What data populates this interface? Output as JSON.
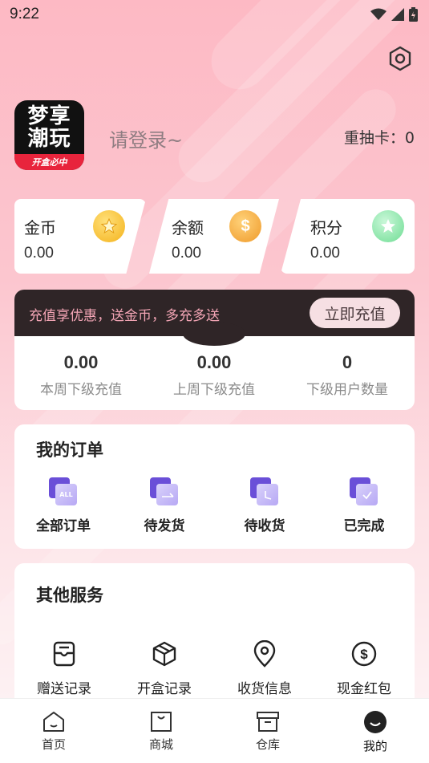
{
  "status_bar": {
    "time": "9:22"
  },
  "header": {
    "logo_line1": "梦享",
    "logo_line2": "潮玩",
    "logo_tag": "开盒必中",
    "login_prompt": "请登录~",
    "redraw_label": "重抽卡：0"
  },
  "wallet": [
    {
      "label": "金币",
      "value": "0.00",
      "icon": "gold-coin-icon"
    },
    {
      "label": "余额",
      "value": "0.00",
      "icon": "balance-coin-icon"
    },
    {
      "label": "积分",
      "value": "0.00",
      "icon": "points-star-icon"
    }
  ],
  "recharge": {
    "promo": "充值享优惠，送金币，多充多送",
    "button": "立即充值",
    "stats": [
      {
        "value": "0.00",
        "label": "本周下级充值"
      },
      {
        "value": "0.00",
        "label": "上周下级充值"
      },
      {
        "value": "0",
        "label": "下级用户数量"
      }
    ]
  },
  "orders": {
    "title": "我的订单",
    "items": [
      {
        "label": "全部订单",
        "icon": "all-orders-icon",
        "badge": "ALL"
      },
      {
        "label": "待发货",
        "icon": "pending-ship-icon"
      },
      {
        "label": "待收货",
        "icon": "pending-receive-icon"
      },
      {
        "label": "已完成",
        "icon": "completed-icon"
      }
    ]
  },
  "services": {
    "title": "其他服务",
    "items": [
      {
        "label": "赠送记录",
        "icon": "gift-record-icon"
      },
      {
        "label": "开盒记录",
        "icon": "box-record-icon"
      },
      {
        "label": "收货信息",
        "icon": "location-icon"
      },
      {
        "label": "现金红包",
        "icon": "cash-redpacket-icon"
      }
    ]
  },
  "tabbar": [
    {
      "label": "首页",
      "icon": "home-icon"
    },
    {
      "label": "商城",
      "icon": "shop-bag-icon"
    },
    {
      "label": "仓库",
      "icon": "warehouse-icon"
    },
    {
      "label": "我的",
      "icon": "profile-icon",
      "active": true
    }
  ],
  "colors": {
    "accent_pink": "#fdb9c4",
    "dark_banner": "#2f2527",
    "order_purple": "#6a4fd8"
  }
}
